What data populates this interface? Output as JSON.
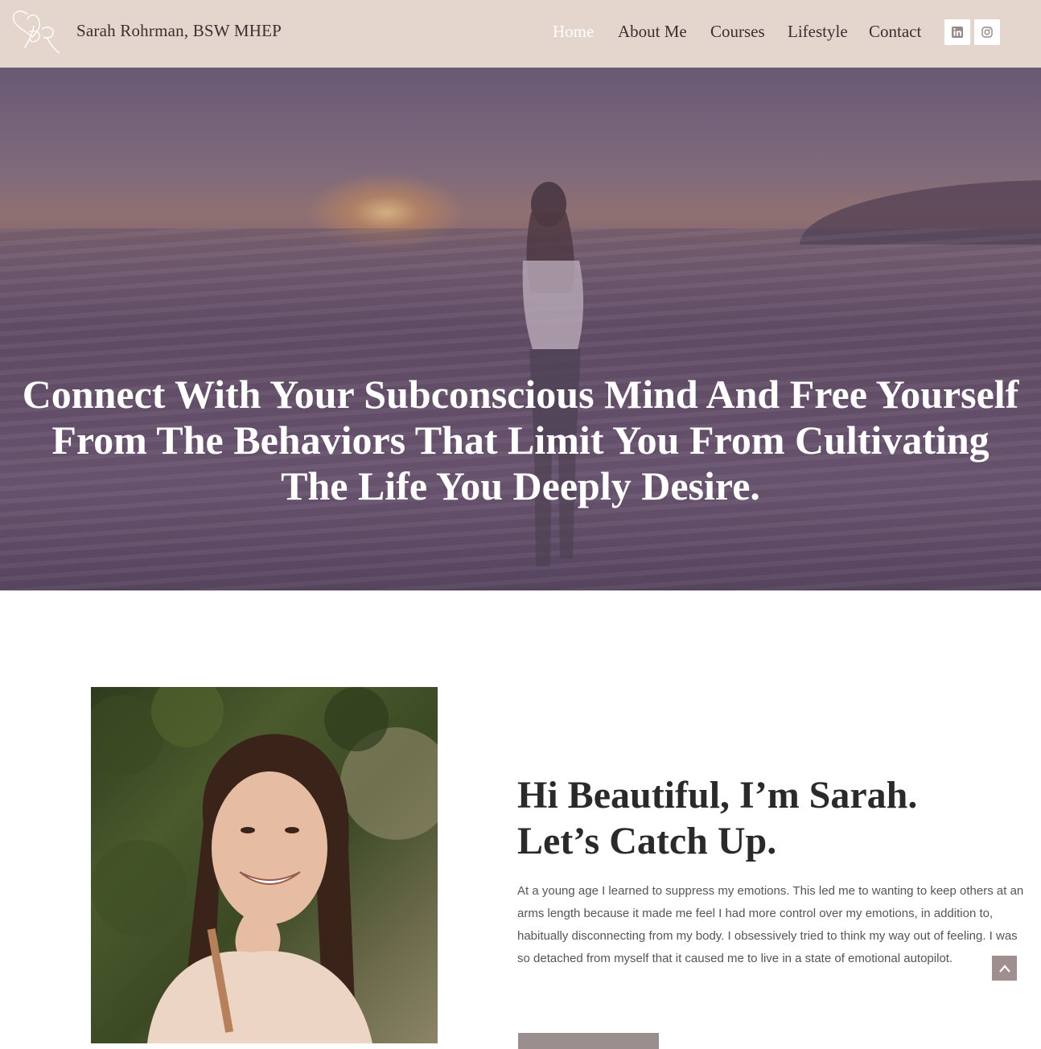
{
  "header": {
    "site_title": "Sarah Rohrman, BSW MHEP",
    "logo_icon": "sr-monogram-hearts-logo",
    "background_color": "#e4d6cd"
  },
  "nav": {
    "items": [
      {
        "label": "Home",
        "active": true
      },
      {
        "label": "About Me",
        "active": false
      },
      {
        "label": "Courses",
        "active": false
      },
      {
        "label": "Lifestyle",
        "active": false
      },
      {
        "label": "Contact",
        "active": false
      }
    ],
    "social": [
      {
        "icon": "linkedin-icon"
      },
      {
        "icon": "instagram-icon"
      }
    ]
  },
  "hero": {
    "title": "Connect With Your Subconscious Mind And Free Yourself From The Behaviors That Limit You From Cultivating The Life You Deeply Desire."
  },
  "about": {
    "heading_line1": "Hi Beautiful, I’m Sarah.",
    "heading_line2": "Let’s Catch Up.",
    "body": "At a young age I learned to suppress my emotions. This led me to wanting to keep others at an arms length because it made me feel I had more control over my emotions, in addition to, habitually disconnecting from my body. I obsessively tried to think my way out of feeling. I was so detached from myself that it caused me to live in a state of emotional autopilot."
  },
  "scroll_top": {
    "icon": "chevron-up-icon"
  },
  "colors": {
    "accent": "#a08f8f",
    "text_dark": "#3b2f2f",
    "body_text": "#555555"
  }
}
